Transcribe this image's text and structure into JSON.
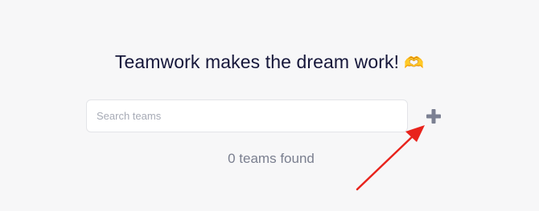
{
  "header": {
    "title": "Teamwork makes the dream work!",
    "emoji": "🫶"
  },
  "search": {
    "placeholder": "Search teams",
    "value": ""
  },
  "add_button": {
    "icon": "plus-icon"
  },
  "results": {
    "count_text": "0 teams found"
  },
  "annotation": {
    "arrow_color": "#e8231c"
  },
  "colors": {
    "background": "#f7f7f8",
    "title": "#16173a",
    "plus": "#7b8092",
    "muted_text": "#7a7f8f"
  }
}
